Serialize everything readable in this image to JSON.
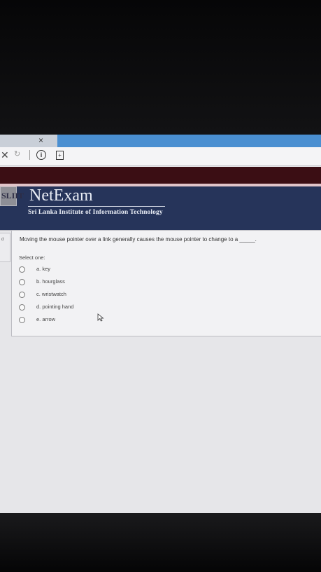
{
  "browser": {
    "tab_close_label": "×",
    "back_icon": "close-icon",
    "back_label": "✕",
    "reload_icon": "reload-icon",
    "reload_label": "↻",
    "info_label": "i",
    "page_label": "+"
  },
  "header": {
    "logo_text": "SLIIT",
    "title": "NetExam",
    "subtitle": "Sri Lanka Institute of Information Technology"
  },
  "left_stub_text": "d",
  "question": {
    "text": "Moving the mouse pointer over a link generally causes the mouse pointer to change to a _____.",
    "select_label": "Select one:",
    "options": [
      {
        "label": "a. key"
      },
      {
        "label": "b. hourglass"
      },
      {
        "label": "c. wristwatch"
      },
      {
        "label": "d. pointing hand"
      },
      {
        "label": "e. arrow"
      }
    ]
  },
  "colors": {
    "header_bg": "#26345a",
    "maroon_band": "#3b0e14",
    "tab_blue": "#4a8fd1"
  }
}
